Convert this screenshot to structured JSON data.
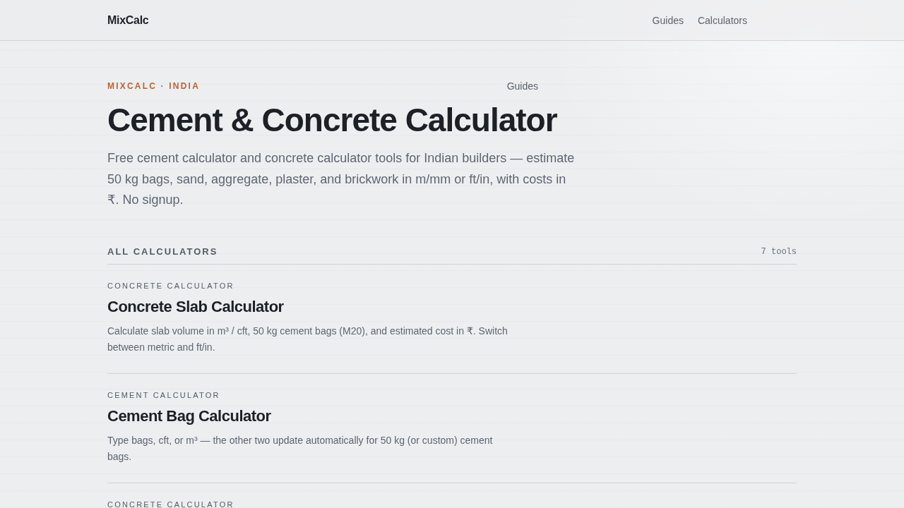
{
  "header": {
    "logo": "MixCalc",
    "nav": [
      "Guides",
      "Calculators"
    ]
  },
  "hero": {
    "eyebrow": "MIXCALC · INDIA",
    "link": "Guides",
    "title": "Cement & Concrete Calculator",
    "intro": "Free cement calculator and concrete calculator tools for Indian builders — estimate 50 kg bags, sand, aggregate, plaster, and brickwork in m/mm or ft/in, with costs in ₹. No signup."
  },
  "section": {
    "heading": "ALL CALCULATORS",
    "count": "7 tools"
  },
  "calculators": [
    {
      "category": "CONCRETE CALCULATOR",
      "title": "Concrete Slab Calculator",
      "description": "Calculate slab volume in m³ / cft, 50 kg cement bags (M20), and estimated cost in ₹. Switch between metric and ft/in."
    },
    {
      "category": "CEMENT CALCULATOR",
      "title": "Cement Bag Calculator",
      "description": "Type bags, cft, or m³ — the other two update automatically for 50 kg (or custom) cement bags."
    },
    {
      "category": "CONCRETE CALCULATOR"
    }
  ]
}
